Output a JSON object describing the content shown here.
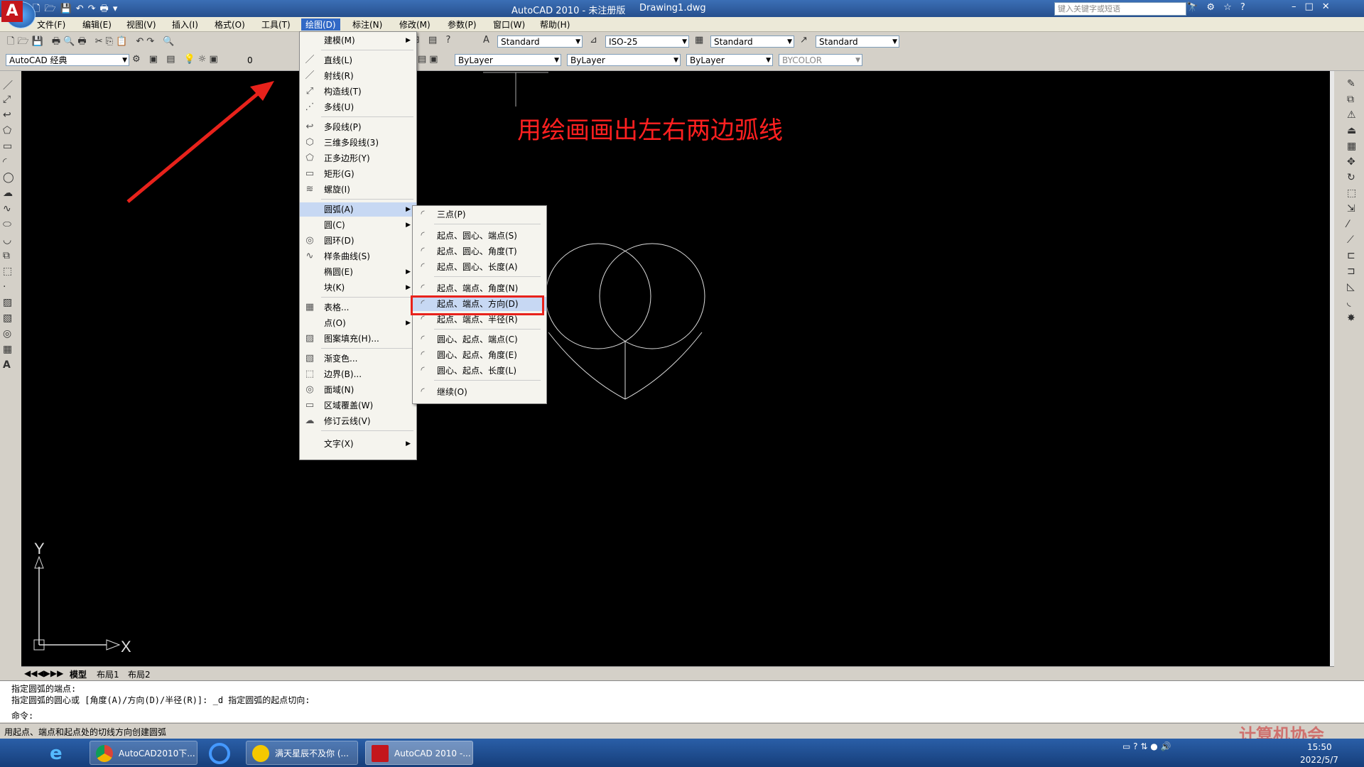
{
  "window": {
    "title": "AutoCAD 2010 - 未注册版",
    "file": "Drawing1.dwg",
    "search_placeholder": "键入关键字或短语",
    "logo": "A"
  },
  "menubar": [
    "文件(F)",
    "编辑(E)",
    "视图(V)",
    "插入(I)",
    "格式(O)",
    "工具(T)",
    "绘图(D)",
    "标注(N)",
    "修改(M)",
    "参数(P)",
    "窗口(W)",
    "帮助(H)"
  ],
  "toolbar": {
    "workspace": "AutoCAD 经典",
    "layer": "0",
    "text_style": "Standard",
    "dim_style": "ISO-25",
    "table_style": "Standard",
    "mleader_style": "Standard",
    "color": "ByLayer",
    "linetype": "ByLayer",
    "lineweight": "ByLayer",
    "plotstyle": "BYCOLOR"
  },
  "draw_menu": [
    "建模(M)",
    "直线(L)",
    "射线(R)",
    "构造线(T)",
    "多线(U)",
    "多段线(P)",
    "三维多段线(3)",
    "正多边形(Y)",
    "矩形(G)",
    "螺旋(I)",
    "圆弧(A)",
    "圆(C)",
    "圆环(D)",
    "样条曲线(S)",
    "椭圆(E)",
    "块(K)",
    "表格...",
    "点(O)",
    "图案填充(H)...",
    "渐变色...",
    "边界(B)...",
    "面域(N)",
    "区域覆盖(W)",
    "修订云线(V)",
    "文字(X)"
  ],
  "arc_submenu": [
    "三点(P)",
    "起点、圆心、端点(S)",
    "起点、圆心、角度(T)",
    "起点、圆心、长度(A)",
    "起点、端点、角度(N)",
    "起点、端点、方向(D)",
    "起点、端点、半径(R)",
    "圆心、起点、端点(C)",
    "圆心、起点、角度(E)",
    "圆心、起点、长度(L)",
    "继续(O)"
  ],
  "annotation": "用绘画画出左右两边弧线",
  "ucs": {
    "y": "Y",
    "x": "X"
  },
  "tabs": [
    "模型",
    "布局1",
    "布局2"
  ],
  "command": {
    "line1": "指定圆弧的端点:",
    "line2": "指定圆弧的圆心或 [角度(A)/方向(D)/半径(R)]: _d 指定圆弧的起点切向:",
    "prompt": "命令:"
  },
  "status_text": "用起点、端点和起点处的切线方向创建圆弧",
  "taskbar": [
    "AutoCAD2010下...",
    "满天星辰不及你 (...",
    "AutoCAD 2010 -..."
  ],
  "clock": {
    "time": "15:50",
    "date": "2022/5/7"
  },
  "watermark": "计算机协会"
}
